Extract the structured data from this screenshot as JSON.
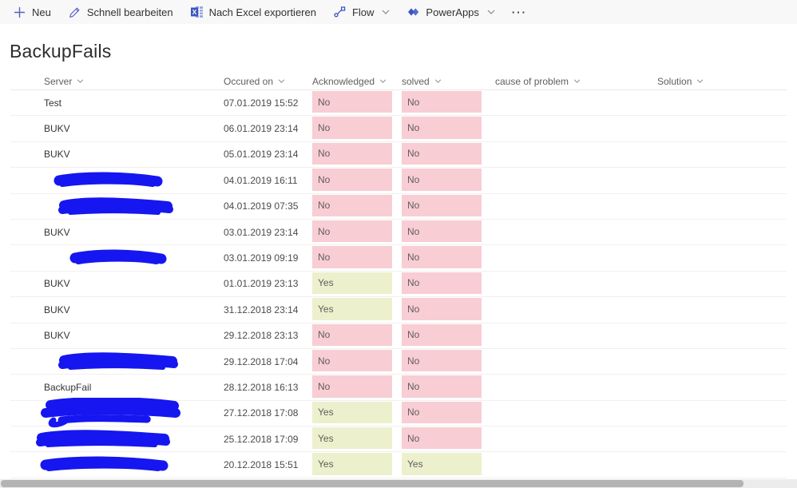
{
  "toolbar": {
    "items": [
      {
        "label": "Neu",
        "icon": "plus-icon"
      },
      {
        "label": "Schnell bearbeiten",
        "icon": "pencil-icon"
      },
      {
        "label": "Nach Excel exportieren",
        "icon": "excel-icon"
      },
      {
        "label": "Flow",
        "icon": "flow-icon",
        "chevron": true
      },
      {
        "label": "PowerApps",
        "icon": "powerapps-icon",
        "chevron": true
      }
    ],
    "more_label": "···"
  },
  "page": {
    "title": "BackupFails"
  },
  "table": {
    "columns": [
      "Server",
      "Occured on",
      "Acknowledged",
      "solved",
      "cause of problem",
      "Solution"
    ],
    "rows": [
      {
        "server": "Test",
        "occured_on": "07.01.2019 15:52",
        "acknowledged": "No",
        "solved": "No",
        "cause": "",
        "solution": ""
      },
      {
        "server": "BUKV",
        "occured_on": "06.01.2019 23:14",
        "acknowledged": "No",
        "solved": "No",
        "cause": "",
        "solution": ""
      },
      {
        "server": "BUKV",
        "occured_on": "05.01.2019 23:14",
        "acknowledged": "No",
        "solved": "No",
        "cause": "",
        "solution": ""
      },
      {
        "server": "",
        "redaction": {
          "x": 22,
          "w": 143,
          "v": 1
        },
        "occured_on": "04.01.2019 16:11",
        "acknowledged": "No",
        "solved": "No",
        "cause": "",
        "solution": ""
      },
      {
        "server": "",
        "redaction": {
          "x": 28,
          "w": 152,
          "v": 2
        },
        "occured_on": "04.01.2019 07:35",
        "acknowledged": "No",
        "solved": "No",
        "cause": "",
        "solution": ""
      },
      {
        "server": "BUKV",
        "occured_on": "03.01.2019 23:14",
        "acknowledged": "No",
        "solved": "No",
        "cause": "",
        "solution": ""
      },
      {
        "server": "",
        "redaction": {
          "x": 42,
          "w": 128,
          "v": 1
        },
        "occured_on": "03.01.2019 09:19",
        "acknowledged": "No",
        "solved": "No",
        "cause": "",
        "solution": ""
      },
      {
        "server": "BUKV",
        "occured_on": "01.01.2019 23:13",
        "acknowledged": "Yes",
        "solved": "No",
        "cause": "",
        "solution": ""
      },
      {
        "server": "BUKV",
        "occured_on": "31.12.2018 23:14",
        "acknowledged": "Yes",
        "solved": "No",
        "cause": "",
        "solution": ""
      },
      {
        "server": "BUKV",
        "occured_on": "29.12.2018 23:13",
        "acknowledged": "No",
        "solved": "No",
        "cause": "",
        "solution": ""
      },
      {
        "server": "",
        "redaction": {
          "x": 28,
          "w": 158,
          "v": 2
        },
        "occured_on": "29.12.2018 17:04",
        "acknowledged": "No",
        "solved": "No",
        "cause": "",
        "solution": ""
      },
      {
        "server": "BackupFail",
        "occured_on": "28.12.2018 16:13",
        "acknowledged": "No",
        "solved": "No",
        "cause": "",
        "solution": ""
      },
      {
        "server": "",
        "redaction": {
          "x": 5,
          "w": 183,
          "v": 3
        },
        "occured_on": "27.12.2018 17:08",
        "acknowledged": "Yes",
        "solved": "No",
        "cause": "",
        "solution": ""
      },
      {
        "server": "",
        "redaction": {
          "x": 0,
          "w": 176,
          "v": 2
        },
        "occured_on": "25.12.2018 17:09",
        "acknowledged": "Yes",
        "solved": "No",
        "cause": "",
        "solution": ""
      },
      {
        "server": "",
        "redaction": {
          "x": 5,
          "w": 167,
          "v": 1
        },
        "occured_on": "20.12.2018 15:51",
        "acknowledged": "Yes",
        "solved": "Yes",
        "cause": "",
        "solution": ""
      }
    ]
  },
  "colors": {
    "accent": "#5b5fc7",
    "icon_blue": "#3b56c4",
    "yes_bg": "#edf0cd",
    "no_bg": "#f8cdd4",
    "badge_text": "#605e5c",
    "redaction": "#1616f0"
  }
}
